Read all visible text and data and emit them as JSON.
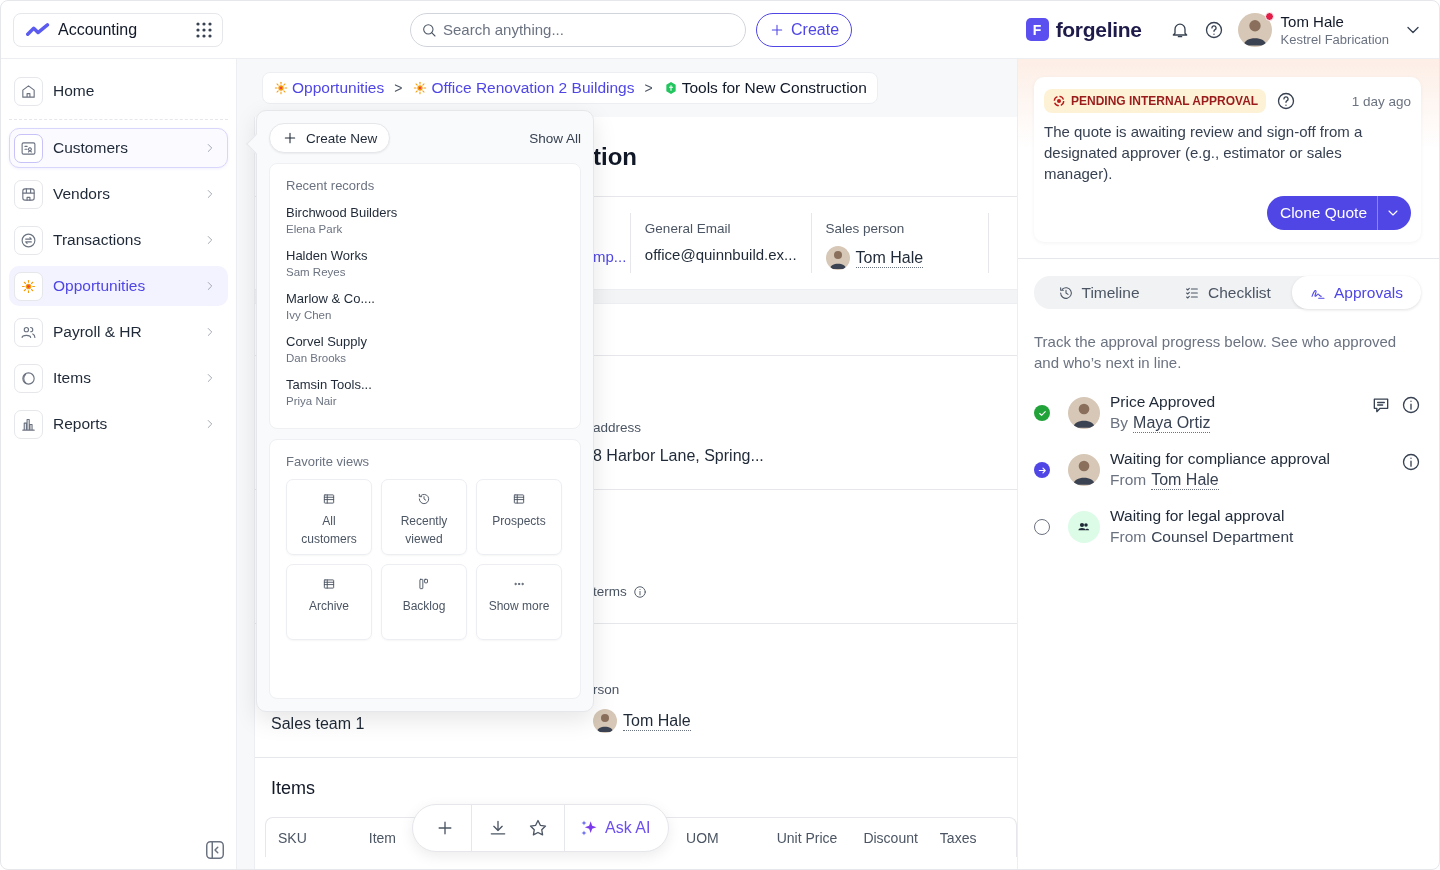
{
  "topbar": {
    "app": {
      "name": "Accounting"
    },
    "search": {
      "placeholder": "Search anything..."
    },
    "create_button": "Create",
    "brand": {
      "letter": "F",
      "name": "forgeline"
    },
    "user": {
      "name": "Tom Hale",
      "company": "Kestrel Fabrication",
      "notification": true
    }
  },
  "sidebar": {
    "items": [
      {
        "label": "Home",
        "kind": "link",
        "selected": false,
        "expanded": false
      },
      {
        "label": "Customers",
        "kind": "menu",
        "selected": false,
        "expanded": true
      },
      {
        "label": "Vendors",
        "kind": "menu",
        "selected": false,
        "expanded": false
      },
      {
        "label": "Transactions",
        "kind": "menu",
        "selected": false,
        "expanded": false
      },
      {
        "label": "Opportunities",
        "kind": "menu",
        "selected": true,
        "expanded": false
      },
      {
        "label": "Payroll & HR",
        "kind": "menu",
        "selected": false,
        "expanded": false
      },
      {
        "label": "Items",
        "kind": "menu",
        "selected": false,
        "expanded": false
      },
      {
        "label": "Reports",
        "kind": "menu",
        "selected": false,
        "expanded": false
      }
    ]
  },
  "breadcrumb": [
    {
      "kind": "link",
      "label": "Opportunities",
      "current": false
    },
    {
      "kind": "separator",
      "label": ">"
    },
    {
      "kind": "link",
      "label": "Office Renovation 2 Buildings",
      "current": false
    },
    {
      "kind": "separator",
      "label": ">"
    },
    {
      "kind": "link",
      "label": "Tools for New Construction",
      "current": true
    }
  ],
  "record": {
    "title": "tion",
    "info": [
      {
        "value": "mp...",
        "kind": "link"
      },
      {
        "label": "General Email",
        "value": "office@quinnbuild.ex...",
        "kind": "text"
      },
      {
        "label": "Sales person",
        "value": "Tom Hale",
        "kind": "person"
      }
    ],
    "rows": [
      {
        "label": "address",
        "value": "8 Harbor Lane, Spring...",
        "kind": "text",
        "info": false
      },
      {
        "label": "terms",
        "info": true
      },
      {
        "left": "Sales team 1",
        "label": "rson",
        "value": "Tom Hale",
        "kind": "person",
        "info": false
      }
    ],
    "items": {
      "title": "Items",
      "columns": [
        "SKU",
        "Item",
        "UOM",
        "Unit Price",
        "Discount",
        "Taxes"
      ]
    }
  },
  "popover": {
    "create_button": "Create New",
    "show_all": "Show All",
    "recent": {
      "title": "Recent records",
      "records": [
        {
          "name": "Birchwood Builders",
          "contact": "Elena Park"
        },
        {
          "name": "Halden Works",
          "contact": "Sam Reyes"
        },
        {
          "name": "Marlow & Co....",
          "contact": "Ivy Chen"
        },
        {
          "name": "Corvel Supply",
          "contact": "Dan Brooks"
        },
        {
          "name": "Tamsin Tools...",
          "contact": "Priya Nair"
        }
      ]
    },
    "favorites": {
      "title": "Favorite views",
      "views": [
        {
          "label": "All customers"
        },
        {
          "label": "Recently viewed"
        },
        {
          "label": "Prospects"
        },
        {
          "label": "Archive"
        },
        {
          "label": "Backlog"
        },
        {
          "label": "Show more"
        }
      ]
    }
  },
  "toolbar": {
    "ask_ai": "Ask AI"
  },
  "approval_card": {
    "status": "PENDING INTERNAL APPROVAL",
    "time": "1 day ago",
    "text": "The quote is awaiting review and sign-off from a designated approver (e.g., estimator or sales manager).",
    "button": "Clone Quote"
  },
  "tabs": [
    {
      "label": "Timeline",
      "selected": false
    },
    {
      "label": "Checklist",
      "selected": false
    },
    {
      "label": "Approvals",
      "selected": true
    }
  ],
  "approvals": {
    "intro": "Track the approval progress below. See who approved and who’s next in line.",
    "steps": [
      {
        "title": "Price Approved",
        "prefix": "By",
        "who": "Maya Ortiz",
        "kind": "done",
        "comment": true
      },
      {
        "title": "Waiting for compliance approval",
        "prefix": "From",
        "who": "Tom Hale",
        "kind": "current",
        "comment": false
      },
      {
        "title": "Waiting for legal approval",
        "prefix": "From",
        "who": "Counsel Department",
        "kind": "pending",
        "comment": false
      }
    ]
  }
}
